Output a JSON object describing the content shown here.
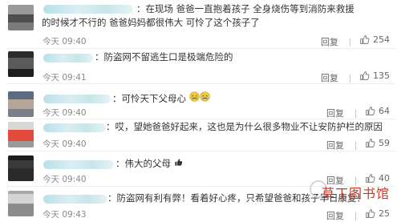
{
  "comments": [
    {
      "text": "：在现场 爸爸一直抱着孩子 全身烧伤等到消防来救援的时候才不行的 爸爸妈妈都很伟大 可怜了这个孩子了",
      "time": "今天 09:40",
      "reply_label": "回复",
      "likes": "254"
    },
    {
      "text": "：防盗网不留逃生口是极端危险的",
      "time": "今天 09:41",
      "reply_label": "回复",
      "likes": "135"
    },
    {
      "text": "：可怜天下父母心",
      "time": "今天 09:40",
      "reply_label": "回复",
      "likes": "64"
    },
    {
      "text": "：哎，望她爸爸好起来，这也是为什么很多物业不让安防护栏的原因",
      "time": "今天 09:40",
      "reply_label": "回复",
      "likes": "59"
    },
    {
      "text": "：伟大的父母",
      "time": "今天 09:40",
      "reply_label": "回复",
      "likes": "40"
    },
    {
      "text": "：防盗网有利有弊！看着好心疼，只希望爸爸和孩子早日康复！",
      "time": "今天 09:43",
      "reply_label": "回复",
      "likes": "25"
    }
  ],
  "watermark": {
    "text": "草丁图书馆"
  },
  "icons": {
    "like": "thumbs-up-icon",
    "emoji_crying": "crying-face-emoji",
    "emoji_thumb": "thumbs-up-emoji"
  },
  "colors": {
    "time": "#8a8a8a",
    "watermark": "#c73a2a"
  }
}
